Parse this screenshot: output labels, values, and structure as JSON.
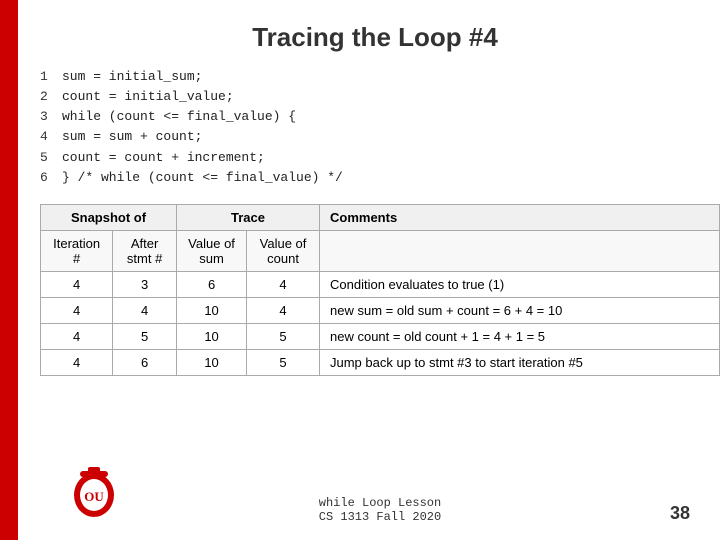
{
  "page": {
    "title": "Tracing the Loop #4",
    "code": [
      {
        "num": "1",
        "text": "sum   = initial_sum;"
      },
      {
        "num": "2",
        "text": "count = initial_value;"
      },
      {
        "num": "3",
        "text": "while (count <= final_value) {"
      },
      {
        "num": "4",
        "text": "    sum = sum + count;"
      },
      {
        "num": "5",
        "text": "    count = count + increment;"
      },
      {
        "num": "6",
        "text": "} /* while (count <= final_value) */"
      }
    ],
    "table": {
      "headers": {
        "snapshot": "Snapshot of",
        "trace": "Trace",
        "comments": "Comments"
      },
      "subheaders": {
        "iteration": "Iteration #",
        "after_stmt": "After stmt #",
        "value_sum": "Value of sum",
        "value_count": "Value of count"
      },
      "rows": [
        {
          "iteration": "4",
          "after_stmt": "3",
          "value_sum": "6",
          "value_count": "4",
          "comment": "Condition evaluates to true (1)"
        },
        {
          "iteration": "4",
          "after_stmt": "4",
          "value_sum": "10",
          "value_count": "4",
          "comment": "new sum = old sum + count = 6 + 4 = 10"
        },
        {
          "iteration": "4",
          "after_stmt": "5",
          "value_sum": "10",
          "value_count": "5",
          "comment": "new count = old count + 1 = 4 + 1 = 5"
        },
        {
          "iteration": "4",
          "after_stmt": "6",
          "value_sum": "10",
          "value_count": "5",
          "comment": "Jump back up to stmt #3 to start iteration #5"
        }
      ]
    },
    "footer": {
      "course": "while Loop Lesson",
      "term": "CS 1313 Fall 2020",
      "page_number": "38"
    }
  }
}
